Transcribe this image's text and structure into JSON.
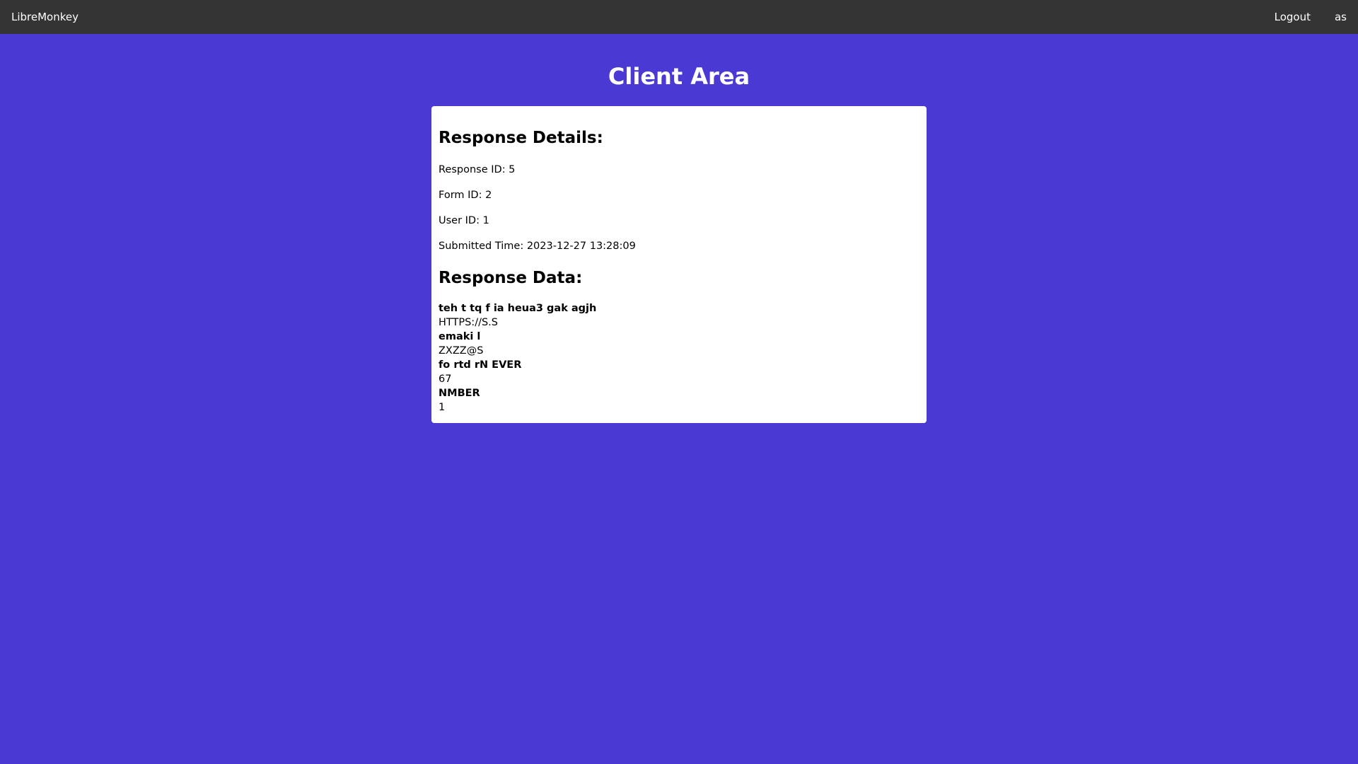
{
  "navbar": {
    "brand": "LibreMonkey",
    "logout": "Logout",
    "user": "as"
  },
  "page": {
    "title": "Client Area"
  },
  "details": {
    "heading": "Response Details:",
    "response_id": "Response ID: 5",
    "form_id": "Form ID: 2",
    "user_id": "User ID: 1",
    "submitted_time": "Submitted Time: 2023-12-27 13:28:09"
  },
  "response_data": {
    "heading": "Response Data:",
    "fields": [
      {
        "label": "teh t tq f ia heua3 gak agjh",
        "value": "HTTPS://S.S"
      },
      {
        "label": "emaki l",
        "value": "ZXZZ@S"
      },
      {
        "label": "fo rtd rN EVER",
        "value": "67"
      },
      {
        "label": "NMBER",
        "value": "1"
      }
    ]
  },
  "colors": {
    "background": "#4a3ad3",
    "navbar": "#343434",
    "card": "#ffffff"
  }
}
